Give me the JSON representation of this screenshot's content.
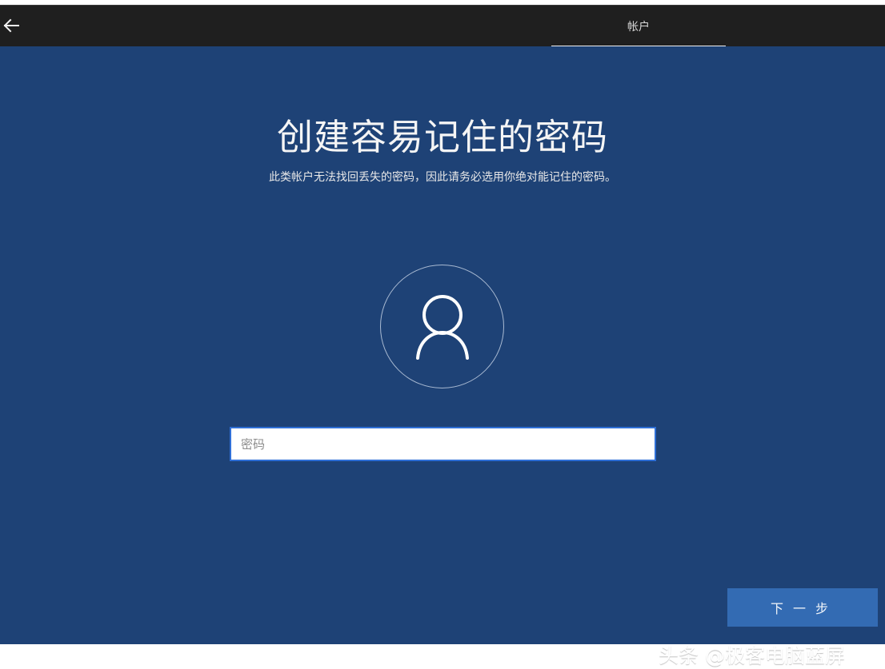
{
  "window": {
    "tab_label": "帐户",
    "back_icon": "back-arrow-icon"
  },
  "page": {
    "title": "创建容易记住的密码",
    "subtitle": "此类帐户无法找回丢失的密码，因此请务必选用你绝对能记住的密码。",
    "avatar_icon": "user-icon"
  },
  "password_field": {
    "placeholder": "密码",
    "value": ""
  },
  "actions": {
    "next_label": "下一步"
  },
  "overlay": {
    "watermark": "头条 @极客电脑蓝屏"
  },
  "colors": {
    "top_bar": "#1f1f1f",
    "background": "#1e4276",
    "accent": "#336bb3",
    "input_border": "#2f6fd6"
  }
}
